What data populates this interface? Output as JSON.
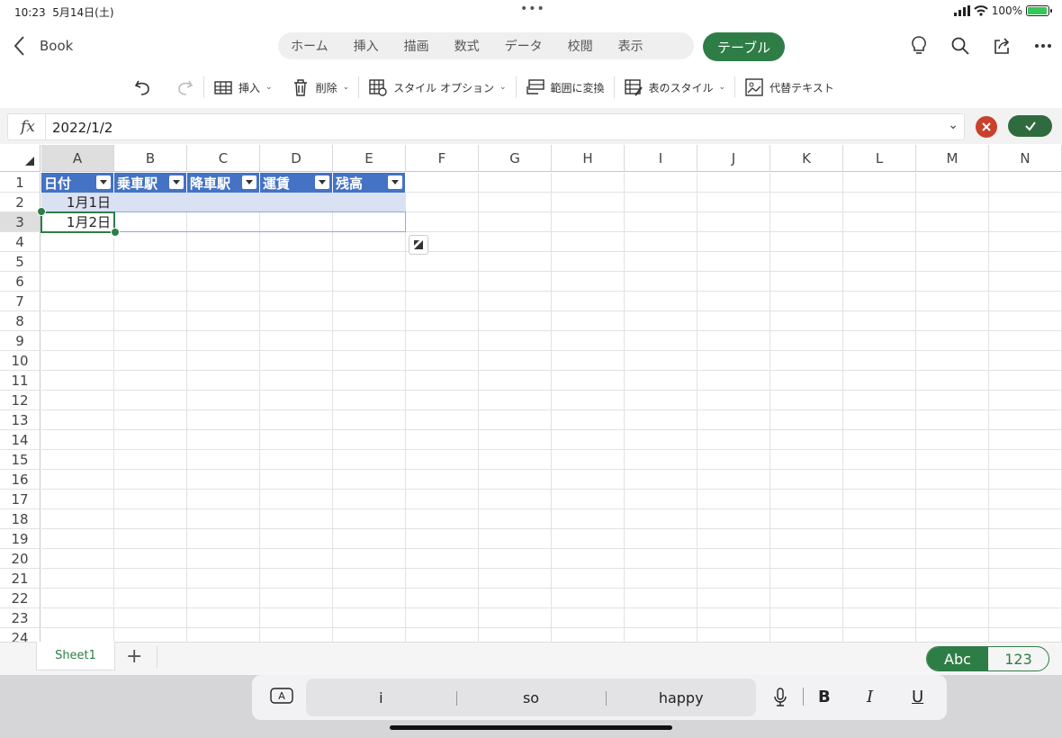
{
  "status": {
    "time": "10:23",
    "date": "5月14日(土)",
    "battery": "100%",
    "battery_level": 1.0
  },
  "top": {
    "back_label": "Book",
    "tabs": [
      "ホーム",
      "挿入",
      "描画",
      "数式",
      "データ",
      "校閲",
      "表示"
    ],
    "active_tab": "テーブル"
  },
  "ribbon": {
    "insert": "挿入",
    "delete": "削除",
    "style_options": "スタイル オプション",
    "convert_range": "範囲に変換",
    "table_style": "表のスタイル",
    "alt_text": "代替テキスト"
  },
  "formula": {
    "fx": "fx",
    "value": "2022/1/2"
  },
  "sheet": {
    "columns": [
      "A",
      "B",
      "C",
      "D",
      "E",
      "F",
      "G",
      "H",
      "I",
      "J",
      "K",
      "L",
      "M",
      "N"
    ],
    "rows": [
      "1",
      "2",
      "3",
      "4",
      "5",
      "6",
      "7",
      "8",
      "9",
      "10",
      "11",
      "12",
      "13",
      "14",
      "15",
      "16",
      "17",
      "18",
      "19",
      "20",
      "21",
      "22",
      "23",
      "24"
    ],
    "table_headers": [
      "日付",
      "乗車駅",
      "降車駅",
      "運賃",
      "残高"
    ],
    "cells": {
      "A2": "1月1日",
      "A3": "1月2日"
    }
  },
  "sheet_tabs": {
    "name": "Sheet1",
    "add": "+",
    "kb_abc": "Abc",
    "kb_num": "123"
  },
  "keyboard": {
    "suggestions": [
      "i",
      "so",
      "happy"
    ],
    "bold": "B",
    "italic": "I",
    "underline": "U",
    "mode_key": "A"
  },
  "colors": {
    "accent": "#2f7d46",
    "table_header": "#4472c4",
    "table_band": "#d9e1f2",
    "cancel": "#c9412c"
  }
}
